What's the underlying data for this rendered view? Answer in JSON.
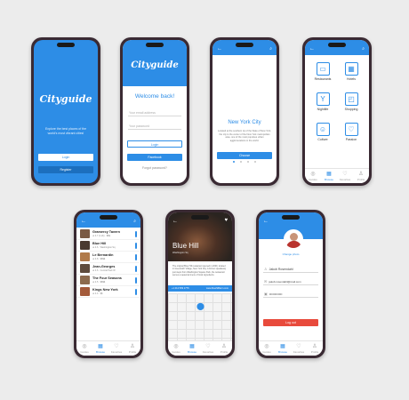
{
  "brand": {
    "name": "Cityguide",
    "tagline": "Explore the best places of the world's most vibrant cities!"
  },
  "splash": {
    "login_label": "Login",
    "register_label": "Register"
  },
  "login": {
    "title": "Welcome back!",
    "email_placeholder": "Your email address",
    "password_placeholder": "Your password",
    "login_label": "Login",
    "facebook_label": "Facebook",
    "forgot_label": "Forgot password?"
  },
  "city": {
    "name": "New York City",
    "description": "Located at the southern tip of the State of New York, the city is the center of the New York metropolitan area, one of the most populous urban agglomerations in the world.",
    "choose_label": "Choose"
  },
  "categories": [
    {
      "label": "Restaurants",
      "icon": "restaurant-icon"
    },
    {
      "label": "Hotels",
      "icon": "hotel-icon"
    },
    {
      "label": "Nightlife",
      "icon": "cocktail-icon"
    },
    {
      "label": "Shopping",
      "icon": "shopping-bag-icon"
    },
    {
      "label": "Culture",
      "icon": "theater-icon"
    },
    {
      "label": "Passion",
      "icon": "heart-icon"
    }
  ],
  "tabs": [
    {
      "label": "Guides",
      "icon": "compass-icon"
    },
    {
      "label": "Browse",
      "icon": "grid-icon"
    },
    {
      "label": "Favorites",
      "icon": "heart-icon"
    },
    {
      "label": "Profile",
      "icon": "user-icon"
    }
  ],
  "restaurants": [
    {
      "name": "Gramercy Tavern",
      "meta": "★ 4.7 (1.2k)  ·  $$$"
    },
    {
      "name": "Blue Hill",
      "meta": "★ 4.6  ·  Washington Sq"
    },
    {
      "name": "Le Bernardin",
      "meta": "★ 4.8  ·  $$$$"
    },
    {
      "name": "Jean-Georges",
      "meta": "★ 4.6  ·  Central Park W"
    },
    {
      "name": "The Four Seasons",
      "meta": "★ 4.5  ·  $$$$"
    },
    {
      "name": "Kings New York",
      "meta": "★ 4.4  ·  $$"
    }
  ],
  "detail": {
    "name": "Blue Hill",
    "meta": "Washington Sq",
    "text": "The original Blue Hill restaurant opened in 2000, located in Greenwich Village, New York City. A former speakeasy just steps from Washington Square Park, the restaurant serves a seasonal menu of local ingredients.",
    "phone": "+1 212 539 1776",
    "web_label": "www.bluehillfarm.com"
  },
  "profile": {
    "change_photo": "Change photo",
    "name": "Jakob Rosendahl",
    "email": "jakob.rosendahl@mail.com",
    "password": "••••••••••••",
    "logout_label": "Log out"
  }
}
